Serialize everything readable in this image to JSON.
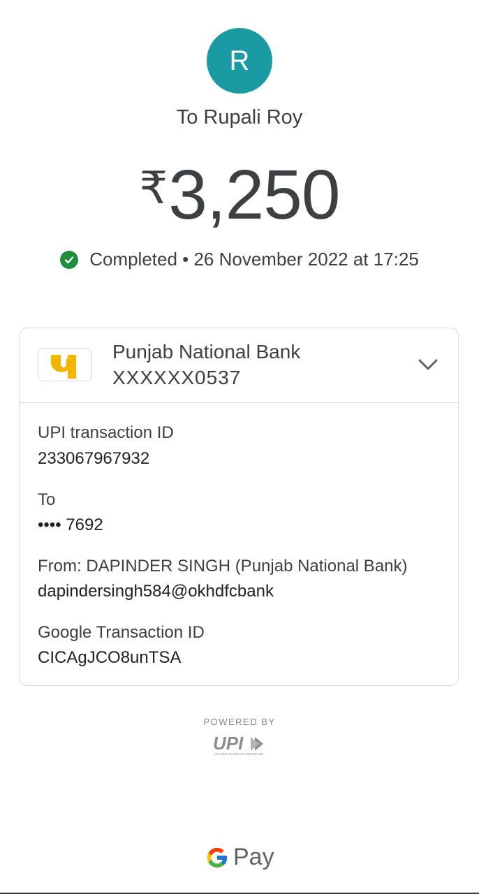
{
  "avatar": {
    "initial": "R",
    "color": "#1a9aa3"
  },
  "recipient": {
    "label": "To Rupali Roy"
  },
  "amount": {
    "currency": "₹",
    "value": "3,250"
  },
  "status": {
    "text": "Completed • 26 November 2022 at 17:25",
    "icon": "check-circle-icon",
    "color": "#1e8e3e"
  },
  "bank": {
    "name": "Punjab National Bank",
    "account": "XXXXXX0537",
    "logo_icon": "pnb-logo-icon",
    "logo_color": "#f5b400"
  },
  "details": [
    {
      "label": "UPI transaction ID",
      "value": "233067967932"
    },
    {
      "label": "To",
      "value": "•••• 7692"
    },
    {
      "label": "From: DAPINDER SINGH (Punjab National Bank)",
      "value": "dapindersingh584@okhdfcbank"
    },
    {
      "label": "Google Transaction ID",
      "value": "CICAgJCO8unTSA"
    }
  ],
  "footer": {
    "powered_by": "POWERED BY",
    "upi_logo_text": "UPI",
    "upi_tagline": "UNIFIED PAYMENTS INTERFACE",
    "gpay_pay": "Pay"
  }
}
